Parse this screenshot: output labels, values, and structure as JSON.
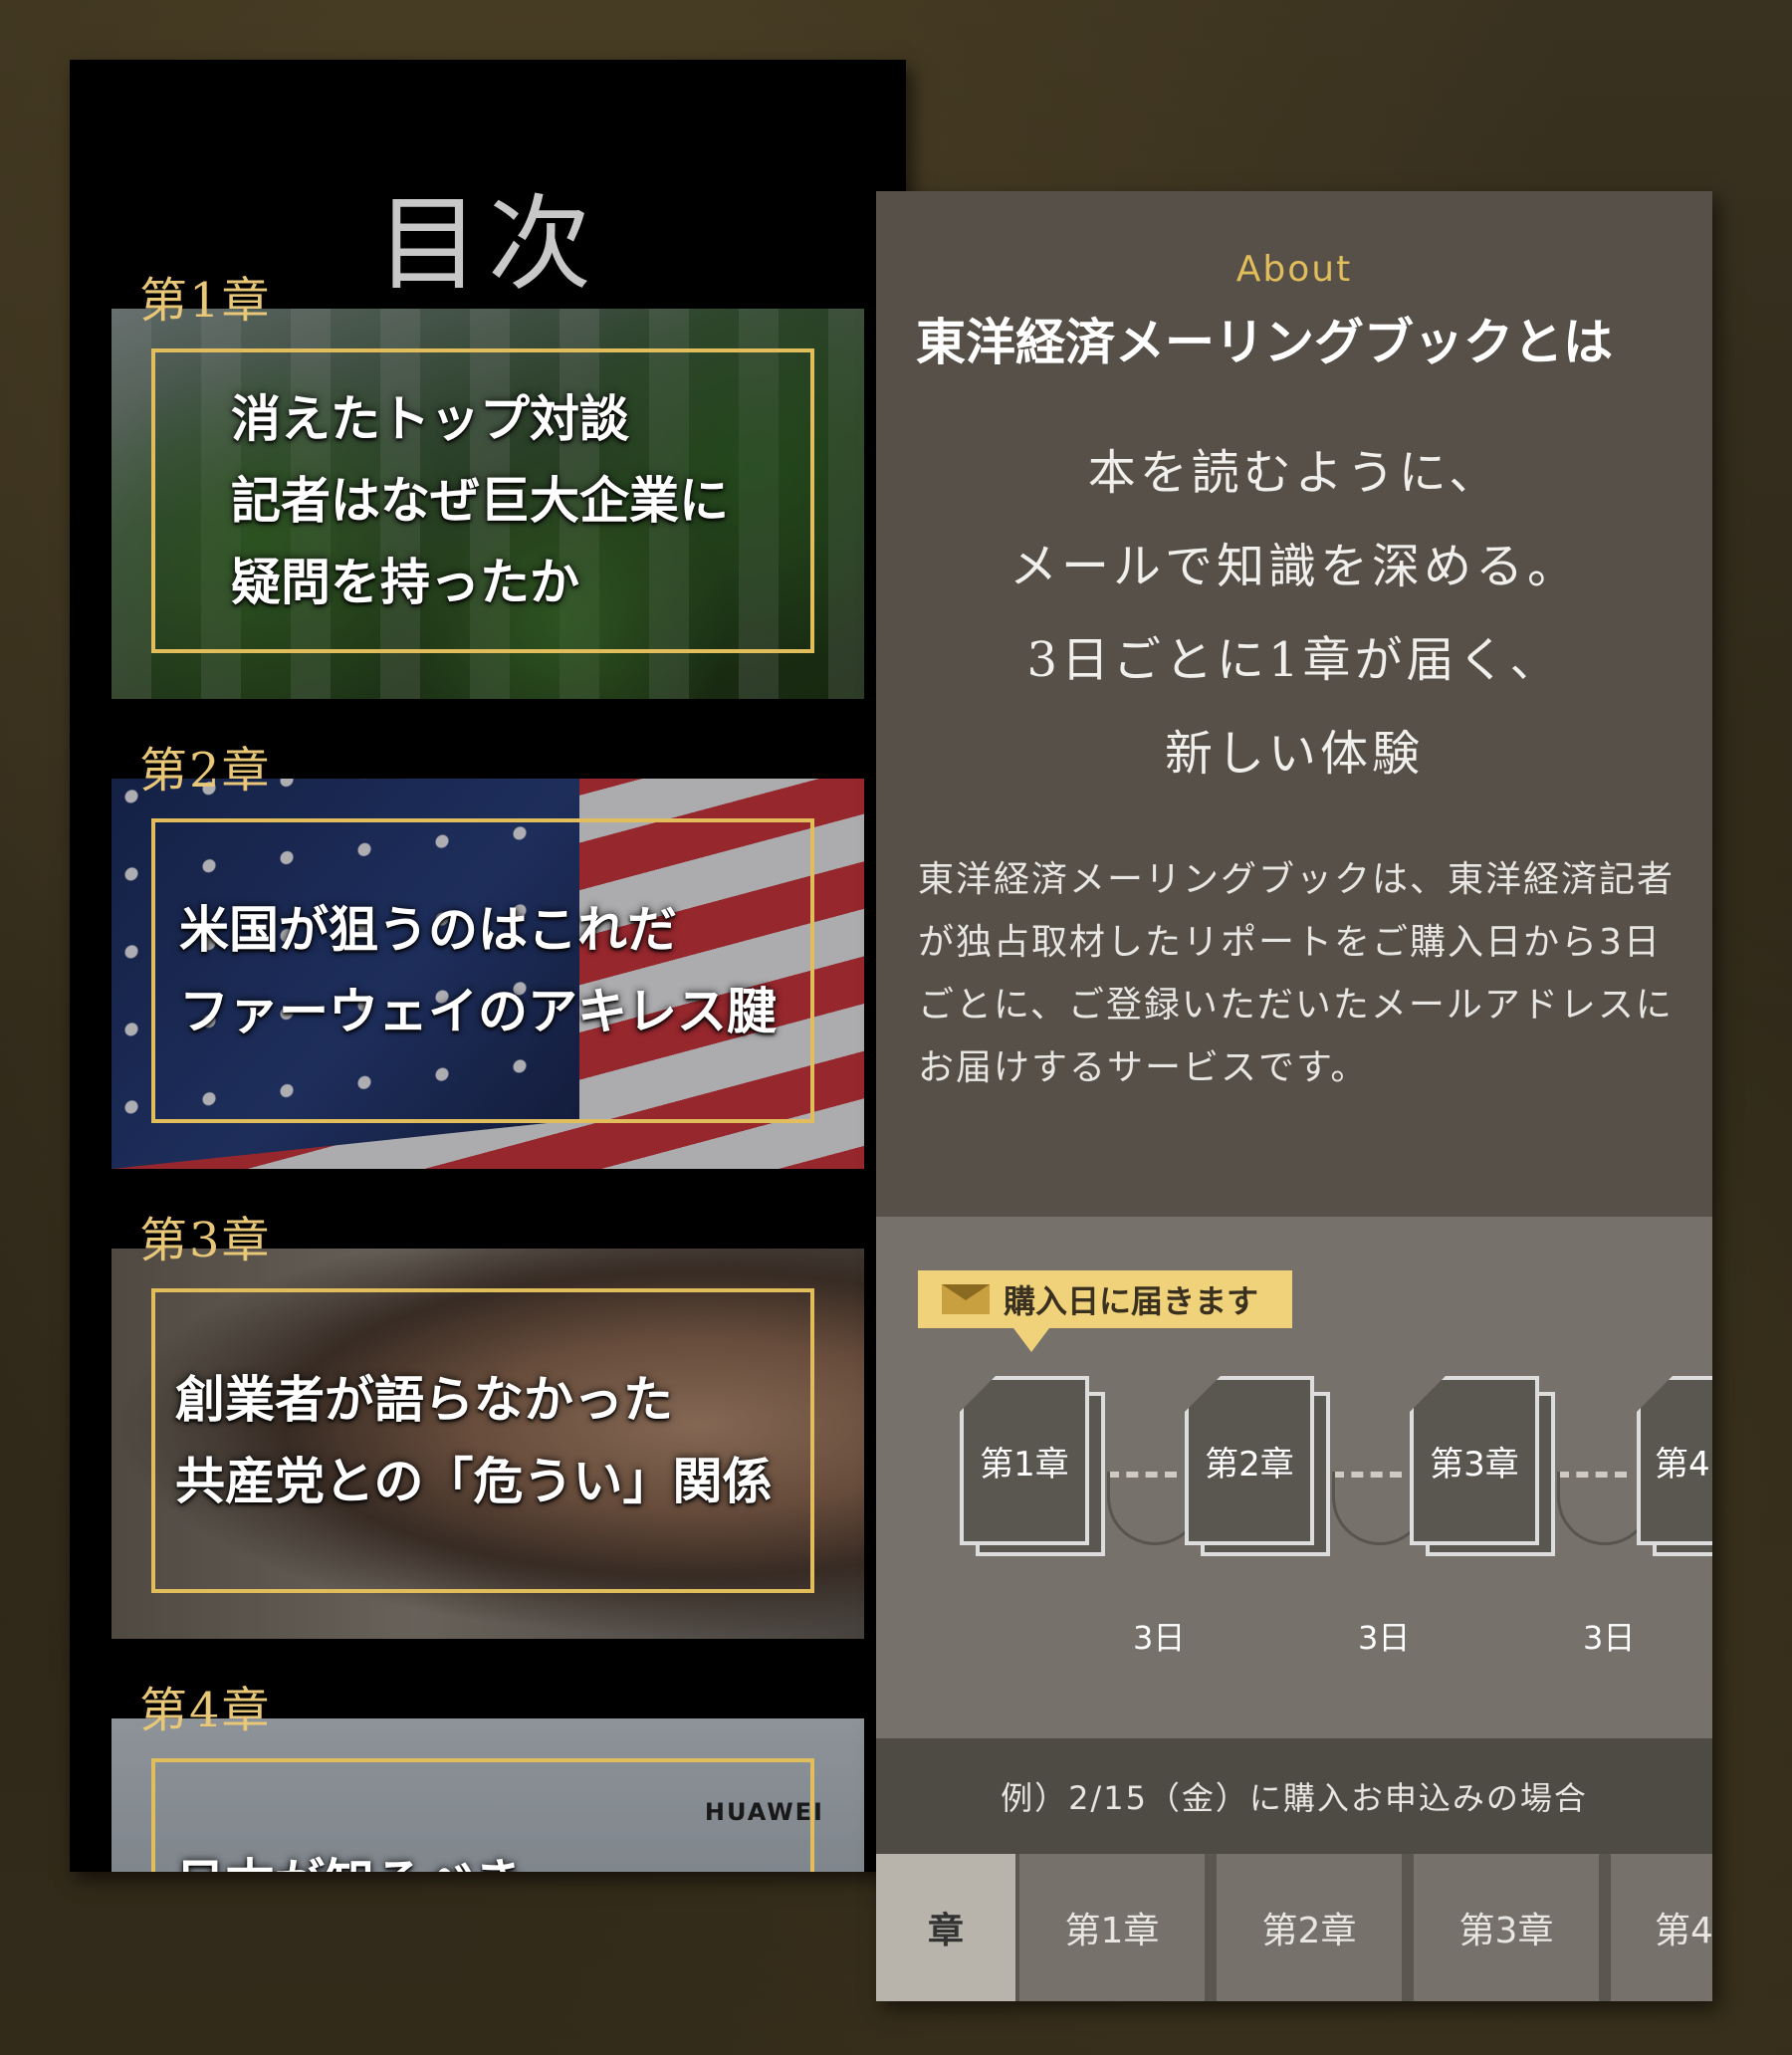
{
  "toc": {
    "title": "目次",
    "chapters": [
      {
        "label": "第1章",
        "lines": [
          "消えたトップ対談",
          "記者はなぜ巨大企業に",
          "疑問を持ったか"
        ]
      },
      {
        "label": "第2章",
        "lines": [
          "米国が狙うのはこれだ",
          "ファーウェイのアキレス腱"
        ]
      },
      {
        "label": "第3章",
        "lines": [
          "創業者が語らなかった",
          "共産党との「危うい」関係"
        ]
      },
      {
        "label": "第4章",
        "lines": [
          "日本が知るべき"
        ],
        "image_text": "HUAWEI"
      }
    ]
  },
  "about": {
    "eyebrow": "About",
    "heading": "東洋経済メーリングブックとは",
    "tagline": [
      "本を読むように、",
      "メールで知識を深める。",
      "3日ごとに1章が届く、",
      "新しい体験"
    ],
    "description": "東洋経済メーリングブックは、東洋経済記者が独占取材したリポートをご購入日から3日ごとに、ご登録いただいたメールアドレスにお届けするサービスです。",
    "timeline": {
      "badge": "購入日に届きます",
      "badge_icon": "mail-icon",
      "chapters": [
        "第1章",
        "第2章",
        "第3章",
        "第4"
      ],
      "intervals": [
        "3日",
        "3日",
        "3日"
      ]
    },
    "example": "例）2/15（金）に購入お申込みの場合",
    "schedule_header": [
      "章",
      "第1章",
      "第2章",
      "第3章",
      "第4"
    ]
  },
  "colors": {
    "gold": "#e2bd5c",
    "badge": "#f0d27a",
    "panel": "#565048"
  }
}
